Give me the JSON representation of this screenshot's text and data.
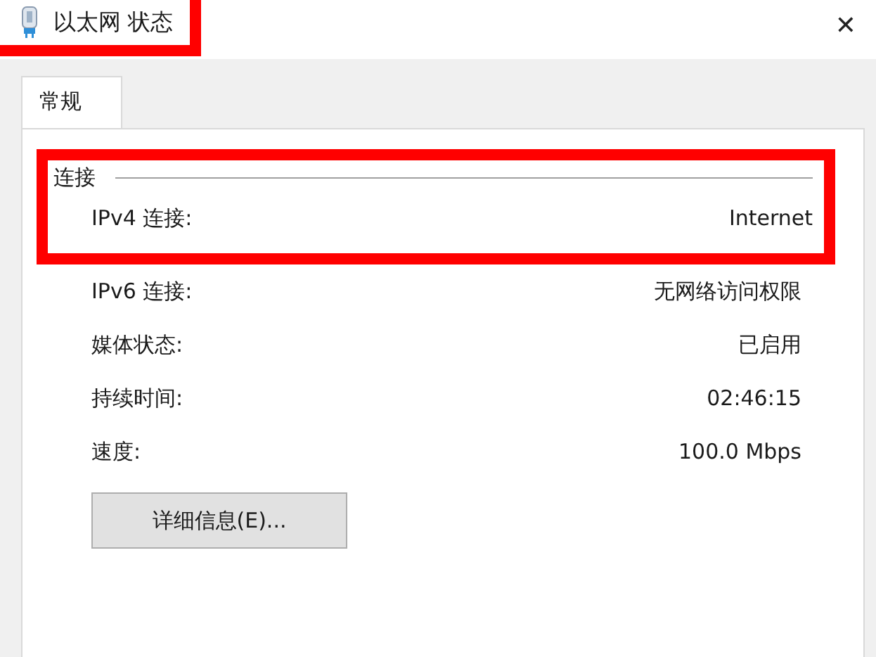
{
  "window": {
    "title": "以太网 状态",
    "highlighted": true,
    "close": "✕"
  },
  "tabs": [
    {
      "label": "常规",
      "selected": true
    }
  ],
  "group": {
    "title": "连接",
    "highlighted": true,
    "rows": [
      {
        "label": "IPv4 连接:",
        "value": "Internet"
      },
      {
        "label": "IPv6 连接:",
        "value": "无网络访问权限"
      },
      {
        "label": "媒体状态:",
        "value": "已启用"
      },
      {
        "label": "持续时间:",
        "value": "02:46:15"
      },
      {
        "label": "速度:",
        "value": "100.0 Mbps"
      }
    ]
  },
  "buttons": [
    "详细信息(E)..."
  ]
}
